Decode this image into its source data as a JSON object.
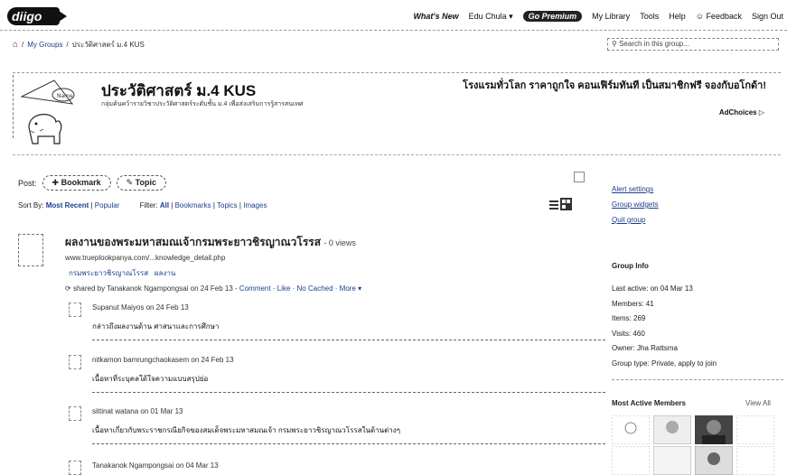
{
  "header": {
    "logo": "diigo",
    "nav": [
      "What's New",
      "Edu Chula",
      "Go Premium",
      "My Library",
      "Tools",
      "Help",
      "Feedback",
      "Sign Out"
    ]
  },
  "breadcrumb": {
    "items": [
      "My Groups",
      "ประวัติศาสตร์ ม.4 KUS"
    ],
    "separator": "/"
  },
  "search": {
    "placeholder": "Search in this group..."
  },
  "group": {
    "title": "ประวัติศาสตร์ ม.4 KUS",
    "description": "กลุ่มค้นคว้ารายวิชาประวัติศาสตร์ระดับชั้น ม.4 เพื่อส่งเสริมการรู้สารสนเทศ",
    "ad_text": "โรงแรมทั่วโลก ราคาถูกใจ คอนเฟิร์มทันที เป็นสมาชิกฟรี จองกับอโกด้า!",
    "ad_choices": "AdChoices"
  },
  "toolbar": {
    "post_label": "Post:",
    "bookmark_label": "Bookmark",
    "topic_label": "Topic",
    "sort_label": "Sort By:",
    "sort_most_recent": "Most Recent",
    "sort_popular": "Popular",
    "filter_label": "Filter:",
    "filter_all": "All",
    "filter_bookmarks": "Bookmarks",
    "filter_topics": "Topics",
    "filter_images": "Images"
  },
  "item": {
    "title": "ผลงานของพระมหาสมณเจ้ากรมพระยาวชิรญาณวโรรส",
    "views": "- 0 views",
    "url": "www.trueplookpanya.com/...knowledge_detail.php",
    "tags": [
      "กรมพระยาวชิรญาณโรรส",
      "ผลงาน"
    ],
    "shared_by": "shared by Tanakanok Ngampongsai on 24 Feb 13",
    "actions": [
      "Comment",
      "Like",
      "No Cached",
      "More"
    ]
  },
  "comments": [
    {
      "author": "Supanut Maiyos on 24 Feb 13",
      "text": "กล่าวถึงผลงานด้าน ศาสนาและการศึกษา"
    },
    {
      "author": "nitkamon bamrungchaokasem on 24 Feb 13",
      "text": "เนื้อหาที่ระบุคลใด้ใจความแบบสรุปย่อ"
    },
    {
      "author": "sittinat watana on 01 Mar 13",
      "text": "เนื้อหาเกี่ยวกับพระราชกรณียกิจของสมเด็จพระมหาสมณเจ้า กรมพระยาวชิรญาณวโรรสในด้านต่างๆ"
    },
    {
      "author": "Tanakanok Ngampongsai on 04 Mar 13",
      "text": ""
    }
  ],
  "sidebar": {
    "links": [
      "Alert settings",
      "Group widgets",
      "Quit group"
    ],
    "group_info_title": "Group Info",
    "info": [
      "Last active: on 04 Mar 13",
      "Members: 41",
      "Items: 269",
      "Visits: 460",
      "Owner: Jha Rattsma",
      "Group type: Private, apply to join"
    ],
    "most_active_title": "Most Active Members",
    "view_all": "View All"
  }
}
